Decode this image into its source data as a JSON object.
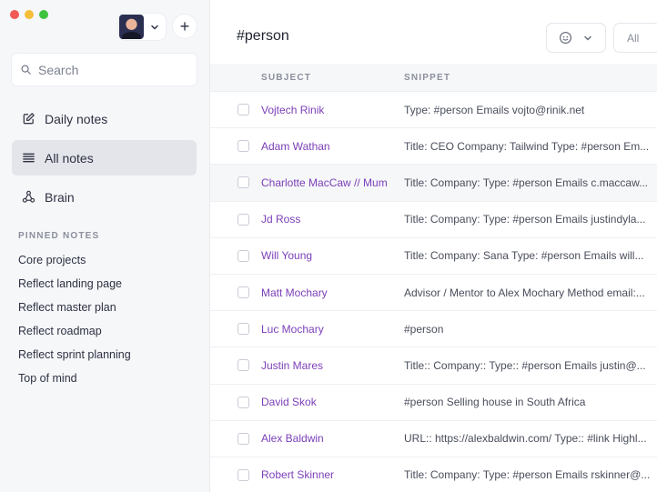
{
  "sidebar": {
    "search_placeholder": "Search",
    "nav": [
      {
        "label": "Daily notes",
        "icon": "pencil-square-icon"
      },
      {
        "label": "All notes",
        "icon": "list-lines-icon",
        "active": true
      },
      {
        "label": "Brain",
        "icon": "graph-nodes-icon"
      }
    ],
    "pinned_heading": "PINNED NOTES",
    "pinned": [
      "Core projects",
      "Reflect landing page",
      "Reflect master plan",
      "Reflect roadmap",
      "Reflect sprint planning",
      "Top of mind"
    ],
    "add_label": "+"
  },
  "main": {
    "title": "#person",
    "filter_all": "All",
    "columns": {
      "subject": "SUBJECT",
      "snippet": "SNIPPET"
    },
    "rows": [
      {
        "subject": "Vojtech Rinik",
        "snippet": "Type: #person Emails vojto@rinik.net"
      },
      {
        "subject": "Adam Wathan",
        "snippet": "Title: CEO Company: Tailwind Type: #person Em..."
      },
      {
        "subject": "Charlotte MacCaw // Mum",
        "snippet": "Title: Company: Type: #person Emails c.maccaw..."
      },
      {
        "subject": "Jd Ross",
        "snippet": "Title: Company: Type: #person Emails justindyla..."
      },
      {
        "subject": "Will Young",
        "snippet": "Title: Company: Sana Type: #person Emails will..."
      },
      {
        "subject": "Matt Mochary",
        "snippet": "Advisor / Mentor to Alex Mochary Method email:..."
      },
      {
        "subject": "Luc Mochary",
        "snippet": "#person"
      },
      {
        "subject": "Justin Mares",
        "snippet": "Title:: Company:: Type:: #person Emails justin@..."
      },
      {
        "subject": "David Skok",
        "snippet": "#person Selling house in South Africa"
      },
      {
        "subject": "Alex Baldwin",
        "snippet": "URL:: https://alexbaldwin.com/ Type:: #link Highl..."
      },
      {
        "subject": "Robert Skinner",
        "snippet": "Title: Company: Type: #person Emails rskinner@..."
      }
    ]
  },
  "colors": {
    "accent_link": "#7b3fb8",
    "sidebar_bg": "#f6f7f9",
    "active_nav": "#e3e5ea"
  }
}
